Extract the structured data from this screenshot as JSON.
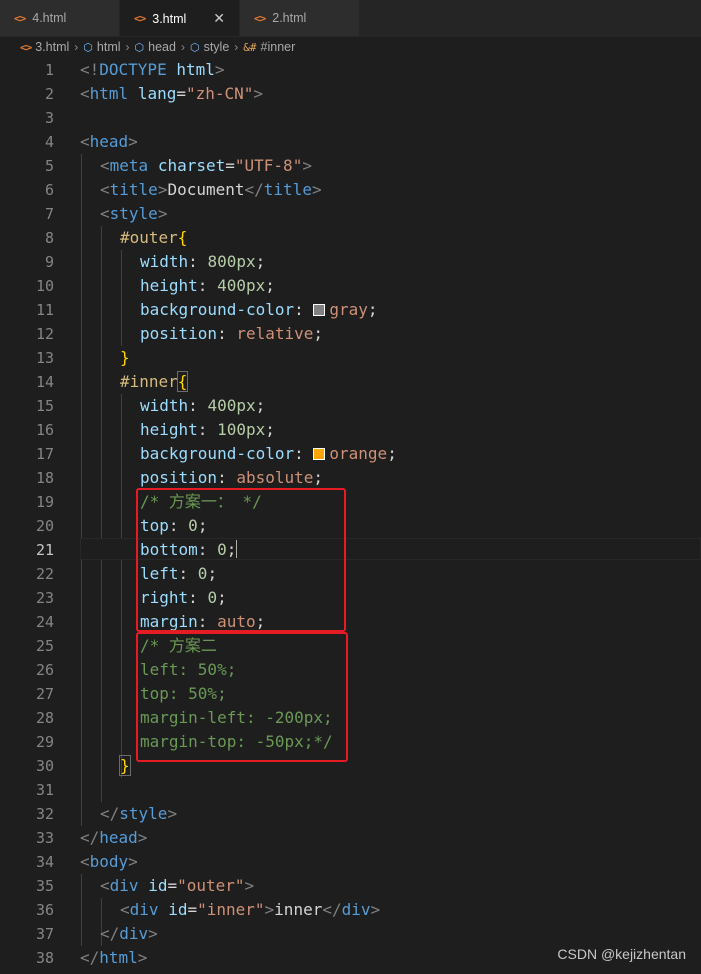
{
  "tabs": [
    {
      "label": "4.html",
      "icon": "html-file-icon",
      "active": false
    },
    {
      "label": "3.html",
      "icon": "html-file-icon",
      "active": true,
      "close": "✕"
    },
    {
      "label": "2.html",
      "icon": "html-file-icon",
      "active": false
    }
  ],
  "breadcrumb": [
    "3.html",
    "html",
    "head",
    "style",
    "#inner"
  ],
  "editor": {
    "active_line": "21",
    "line_numbers": [
      "1",
      "2",
      "3",
      "4",
      "5",
      "6",
      "7",
      "8",
      "9",
      "10",
      "11",
      "12",
      "13",
      "14",
      "15",
      "16",
      "17",
      "18",
      "19",
      "20",
      "21",
      "22",
      "23",
      "24",
      "25",
      "26",
      "27",
      "28",
      "29",
      "30",
      "31",
      "32",
      "33",
      "34",
      "35",
      "36",
      "37",
      "38"
    ],
    "colors": {
      "gray_swatch": "#808080",
      "orange_swatch": "#ffa500",
      "highlight_box": "#e51c23"
    },
    "lines": {
      "l1": [
        "<!",
        "DOCTYPE",
        " ",
        "html",
        ">"
      ],
      "l2": [
        "<",
        "html",
        " ",
        "lang",
        "=",
        "\"zh-CN\"",
        ">"
      ],
      "l4": [
        "<",
        "head",
        ">"
      ],
      "l5": [
        "<",
        "meta",
        " ",
        "charset",
        "=",
        "\"UTF-8\"",
        ">"
      ],
      "l6": [
        "<",
        "title",
        ">",
        "Document",
        "</",
        "title",
        ">"
      ],
      "l7": [
        "<",
        "style",
        ">"
      ],
      "l8": [
        "#outer",
        "{"
      ],
      "l9": [
        "width",
        ": ",
        "800px",
        ";"
      ],
      "l10": [
        "height",
        ": ",
        "400px",
        ";"
      ],
      "l11": [
        "background-color",
        ": ",
        "gray",
        ";"
      ],
      "l12": [
        "position",
        ": ",
        "relative",
        ";"
      ],
      "l13": [
        "}"
      ],
      "l14": [
        "#inner",
        "{"
      ],
      "l15": [
        "width",
        ": ",
        "400px",
        ";"
      ],
      "l16": [
        "height",
        ": ",
        "100px",
        ";"
      ],
      "l17": [
        "background-color",
        ": ",
        "orange",
        ";"
      ],
      "l18": [
        "position",
        ": ",
        "absolute",
        ";"
      ],
      "l19": [
        "/* 方案一： */"
      ],
      "l20": [
        "top",
        ": ",
        "0",
        ";"
      ],
      "l21": [
        "bottom",
        ": ",
        "0",
        ";"
      ],
      "l22": [
        "left",
        ": ",
        "0",
        ";"
      ],
      "l23": [
        "right",
        ": ",
        "0",
        ";"
      ],
      "l24": [
        "margin",
        ": ",
        "auto",
        ";"
      ],
      "l25": [
        "/* 方案二"
      ],
      "l26": [
        "left: 50%;"
      ],
      "l27": [
        "top: 50%;"
      ],
      "l28": [
        "margin-left: -200px;"
      ],
      "l29": [
        "margin-top: -50px;*/"
      ],
      "l30": [
        "}"
      ],
      "l32": [
        "</",
        "style",
        ">"
      ],
      "l33": [
        "</",
        "head",
        ">"
      ],
      "l34": [
        "<",
        "body",
        ">"
      ],
      "l35": [
        "<",
        "div",
        " ",
        "id",
        "=",
        "\"outer\"",
        ">"
      ],
      "l36": [
        "<",
        "div",
        " ",
        "id",
        "=",
        "\"inner\"",
        ">",
        "inner",
        "</",
        "div",
        ">"
      ],
      "l37": [
        "</",
        "div",
        ">"
      ],
      "l38": [
        "</",
        "html",
        ">"
      ]
    }
  },
  "watermark": "CSDN @kejizhentan"
}
